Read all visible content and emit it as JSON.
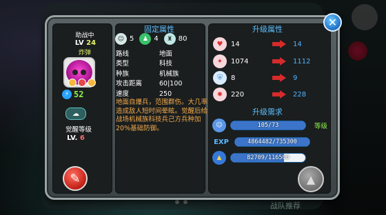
{
  "background": {
    "team_recommend": "战队推荐"
  },
  "hero": {
    "role": "助战中",
    "lv_prefix": "LV",
    "level": "24",
    "name": "炸弹",
    "power": "52",
    "awake_label": "觉醒等级",
    "awake_lv_prefix": "LV.",
    "awake_level": "6"
  },
  "fixed": {
    "title": "固定属性",
    "icon_counts": [
      "5",
      "4",
      "80"
    ],
    "props": [
      {
        "k": "路线",
        "v": "地面"
      },
      {
        "k": "类型",
        "v": "科技"
      },
      {
        "k": "种族",
        "v": "机械族"
      },
      {
        "k": "攻击距离",
        "v": "60|100"
      },
      {
        "k": "速度",
        "v": "250"
      }
    ],
    "description": "地面自爆兵，范围群伤。大几率造成敌人短时间晕眩。觉醒后给战场机械族科技兵己方兵种加20%基础防御。"
  },
  "upgrade": {
    "title": "升级属性",
    "stats": [
      {
        "icon": "heart-icon",
        "from": "14",
        "to": "14"
      },
      {
        "icon": "attack-icon",
        "from": "1074",
        "to": "1112"
      },
      {
        "icon": "shield-icon",
        "from": "8",
        "to": "9"
      },
      {
        "icon": "burst-icon",
        "from": "220",
        "to": "228"
      }
    ],
    "req_title": "升级需求",
    "requirements": [
      {
        "icon": "level-icon",
        "text": "105/73",
        "progress": 1.0,
        "label": "等级"
      },
      {
        "icon": "exp-icon",
        "icon_text": "EXP",
        "text": "4864482/735300",
        "progress": 1.0,
        "label": ""
      },
      {
        "icon": "gold-icon",
        "text": "82709/116500",
        "progress": 0.71,
        "label": ""
      }
    ]
  },
  "colors": {
    "title_blue": "#5fc0ff",
    "level_yellow": "#e8f26a",
    "power_green": "#8cf24a",
    "desc_orange": "#f3a94a",
    "arrow_red": "#d52b2b"
  }
}
